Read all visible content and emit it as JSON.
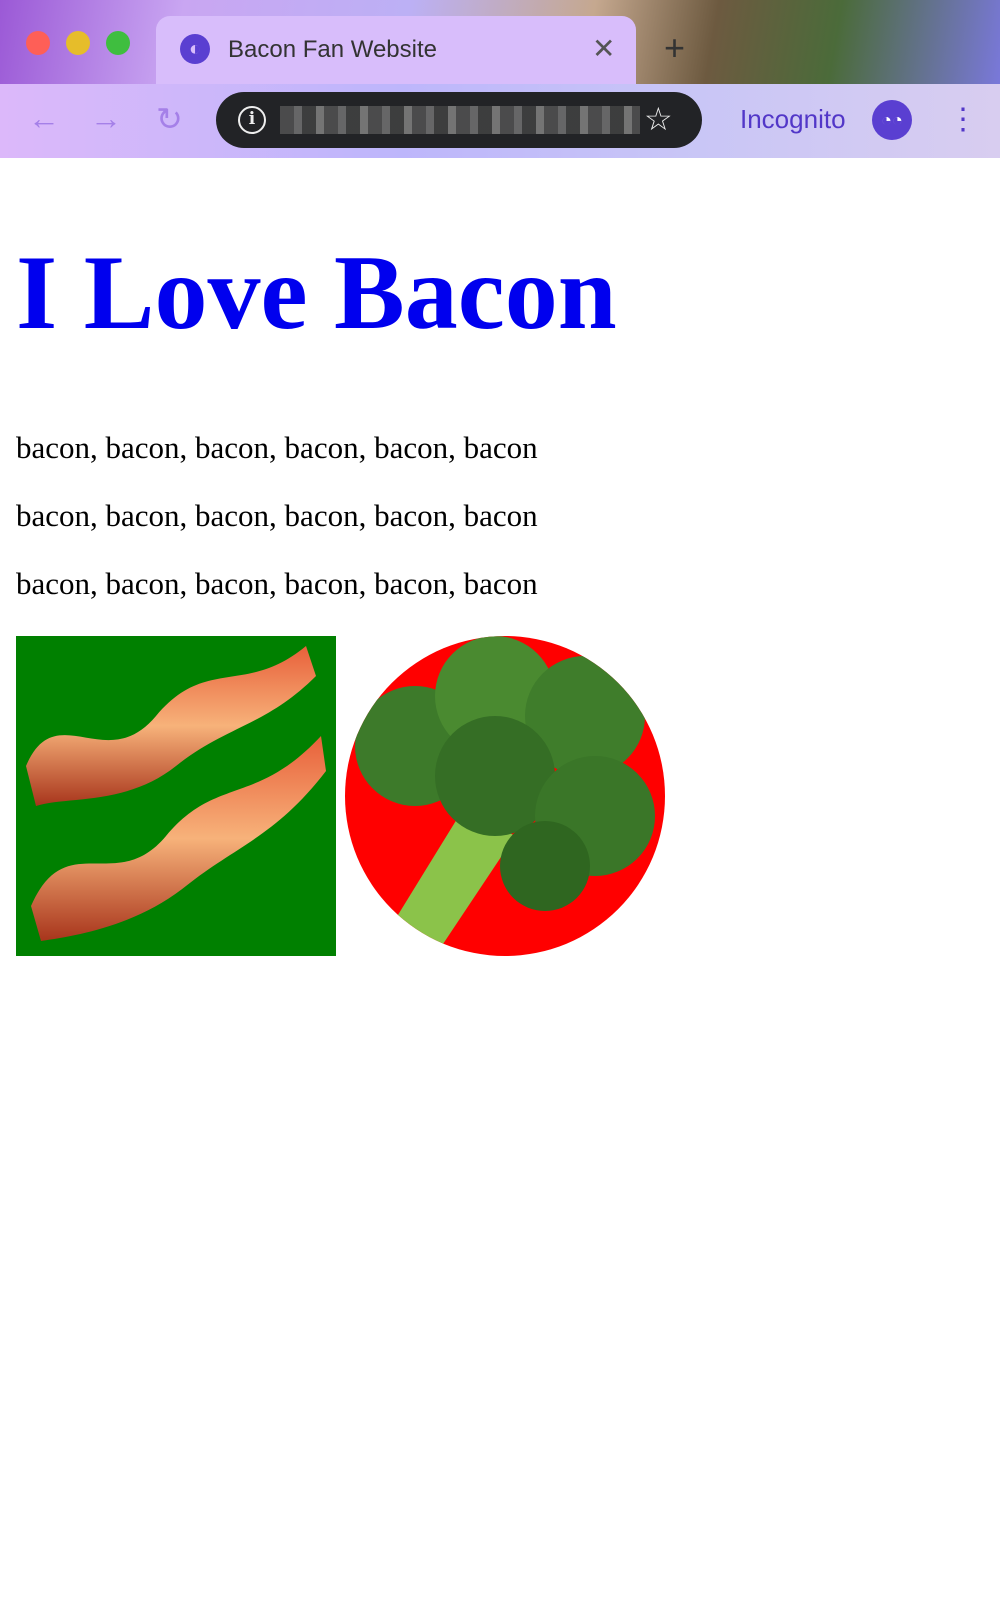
{
  "browser": {
    "tab_title": "Bacon Fan Website",
    "tab_close": "✕",
    "new_tab": "+",
    "back": "←",
    "forward": "→",
    "reload": "↻",
    "info": "i",
    "star": "☆",
    "profile_label": "Incognito",
    "menu": "⋮"
  },
  "page": {
    "heading": "I Love Bacon",
    "paragraphs": [
      "bacon, bacon, bacon, bacon, bacon, bacon",
      "bacon, bacon, bacon, bacon, bacon, bacon",
      "bacon, bacon, bacon, bacon, bacon, bacon"
    ]
  },
  "colors": {
    "heading": "#0000ee",
    "bacon_bg": "#008000",
    "broccoli_bg": "#ff0000"
  }
}
